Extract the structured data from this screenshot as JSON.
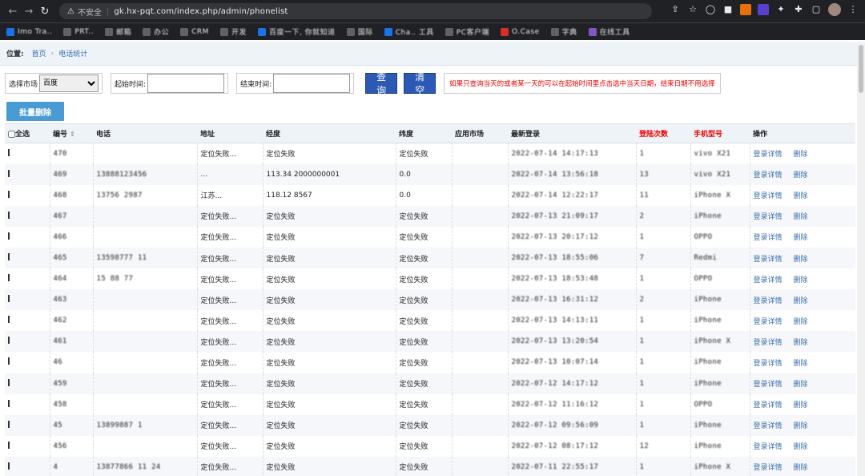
{
  "browser": {
    "insecure_label": "不安全",
    "url": "gk.hx-pqt.com/index.php/admin/phonelist",
    "bookmarks": [
      "Imo Tra..",
      "PRT..",
      "邮箱",
      "办公",
      "CRM",
      "开发",
      "百度一下, 你就知道",
      "国际",
      "Cha.. 工具",
      "PC客户端",
      "O.Case",
      "字典",
      "在线工具"
    ]
  },
  "breadcrumb": {
    "label": "位置:",
    "home": "首页",
    "current": "电话统计"
  },
  "filters": {
    "market_label": "选择市场",
    "market_value": "百度",
    "start_label": "起始时间:",
    "end_label": "结束时间:",
    "query_button": "查询",
    "clear_button": "清空",
    "hint": "如果只查询当天的或者某一天的可以在起始时间里点击选中当天日期，结束日期不用选择"
  },
  "toolbar": {
    "batch_delete": "批量删除"
  },
  "table": {
    "headers": {
      "select_all": "全选",
      "id": "编号",
      "phone": "电话",
      "address": "地址",
      "longitude": "经度",
      "latitude": "纬度",
      "market": "应用市场",
      "last_login": "最新登录",
      "login_count": "登陆次数",
      "model": "手机型号",
      "actions": "操作"
    },
    "action_detail": "登录详情",
    "action_delete": "删除",
    "rows": [
      {
        "id": "470",
        "phone": "",
        "address": "定位失败...",
        "lng": "定位失败",
        "lat": "定位失败",
        "market": "",
        "login": "2022-07-14 14:17:13",
        "count": "1",
        "model": "vivo X21"
      },
      {
        "id": "469",
        "phone": "13888123456",
        "address": "...",
        "lng": "113.34 2000000001",
        "lat": "0.0",
        "market": "",
        "login": "2022-07-14 13:56:18",
        "count": "13",
        "model": "vivo X21"
      },
      {
        "id": "468",
        "phone": "13756 2987",
        "address": "江苏...",
        "lng": "118.12 8567",
        "lat": "0.0",
        "market": "",
        "login": "2022-07-14 12:22:17",
        "count": "11",
        "model": "iPhone X"
      },
      {
        "id": "467",
        "phone": "",
        "address": "定位失败...",
        "lng": "定位失败",
        "lat": "定位失败",
        "market": "",
        "login": "2022-07-13 21:09:17",
        "count": "2",
        "model": "iPhone"
      },
      {
        "id": "466",
        "phone": "",
        "address": "定位失败...",
        "lng": "定位失败",
        "lat": "定位失败",
        "market": "",
        "login": "2022-07-13 20:17:12",
        "count": "1",
        "model": "OPPO"
      },
      {
        "id": "465",
        "phone": "13598777 11",
        "address": "定位失败...",
        "lng": "定位失败",
        "lat": "定位失败",
        "market": "",
        "login": "2022-07-13 18:55:06",
        "count": "7",
        "model": "Redmi"
      },
      {
        "id": "464",
        "phone": "15 88 77",
        "address": "定位失败...",
        "lng": "定位失败",
        "lat": "定位失败",
        "market": "",
        "login": "2022-07-13 18:53:48",
        "count": "1",
        "model": "OPPO"
      },
      {
        "id": "463",
        "phone": "",
        "address": "定位失败...",
        "lng": "定位失败",
        "lat": "定位失败",
        "market": "",
        "login": "2022-07-13 16:31:12",
        "count": "2",
        "model": "iPhone"
      },
      {
        "id": "462",
        "phone": "",
        "address": "定位失败...",
        "lng": "定位失败",
        "lat": "定位失败",
        "market": "",
        "login": "2022-07-13 14:13:11",
        "count": "1",
        "model": "iPhone"
      },
      {
        "id": "461",
        "phone": "",
        "address": "定位失败...",
        "lng": "定位失败",
        "lat": "定位失败",
        "market": "",
        "login": "2022-07-13 13:20:54",
        "count": "1",
        "model": "iPhone X"
      },
      {
        "id": "46",
        "phone": "",
        "address": "定位失败...",
        "lng": "定位失败",
        "lat": "定位失败",
        "market": "",
        "login": "2022-07-13 10:07:14",
        "count": "1",
        "model": "iPhone"
      },
      {
        "id": "459",
        "phone": "",
        "address": "定位失败...",
        "lng": "定位失败",
        "lat": "定位失败",
        "market": "",
        "login": "2022-07-12 14:17:12",
        "count": "1",
        "model": "iPhone"
      },
      {
        "id": "458",
        "phone": "",
        "address": "定位失败...",
        "lng": "定位失败",
        "lat": "定位失败",
        "market": "",
        "login": "2022-07-12 11:16:12",
        "count": "1",
        "model": "OPPO"
      },
      {
        "id": "45",
        "phone": "13899887 1",
        "address": "定位失败...",
        "lng": "定位失败",
        "lat": "定位失败",
        "market": "",
        "login": "2022-07-12 09:56:09",
        "count": "1",
        "model": "iPhone"
      },
      {
        "id": "456",
        "phone": "",
        "address": "定位失败...",
        "lng": "定位失败",
        "lat": "定位失败",
        "market": "",
        "login": "2022-07-12 08:17:12",
        "count": "12",
        "model": "iPhone"
      },
      {
        "id": "4",
        "phone": "13877866 11 24",
        "address": "定位失败...",
        "lng": "定位失败",
        "lat": "定位失败",
        "market": "",
        "login": "2022-07-11 22:55:17",
        "count": "1",
        "model": "iPhone X"
      }
    ]
  },
  "colors": {
    "accent_blue": "#2b59b3",
    "link_blue": "#3a6fb0",
    "warning_red": "#e00000",
    "batch_button": "#4a9ad4"
  }
}
